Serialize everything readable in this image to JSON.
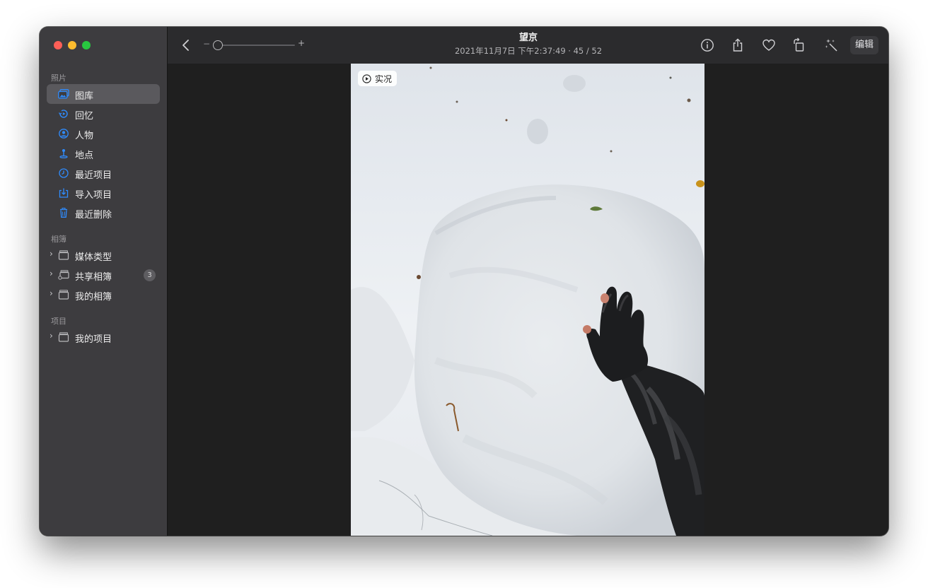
{
  "sidebar": {
    "sections": {
      "photos": "照片",
      "albums": "相簿",
      "projects": "项目"
    },
    "items": [
      {
        "label": "图库",
        "icon": "photo-library-icon",
        "selected": true
      },
      {
        "label": "回忆",
        "icon": "memories-icon"
      },
      {
        "label": "人物",
        "icon": "people-icon"
      },
      {
        "label": "地点",
        "icon": "places-icon"
      },
      {
        "label": "最近项目",
        "icon": "recents-icon"
      },
      {
        "label": "导入项目",
        "icon": "imports-icon"
      },
      {
        "label": "最近删除",
        "icon": "trash-icon"
      }
    ],
    "album_items": [
      {
        "label": "媒体类型",
        "icon": "folder-icon"
      },
      {
        "label": "共享相簿",
        "icon": "shared-folder-icon",
        "badge": "3"
      },
      {
        "label": "我的相簿",
        "icon": "folder-icon"
      }
    ],
    "project_items": [
      {
        "label": "我的项目",
        "icon": "folder-icon"
      }
    ]
  },
  "toolbar": {
    "title": "望京",
    "subtitle": "2021年11月7日 下午2:37:49 · 45 / 52",
    "zoom_minus": "−",
    "zoom_plus": "+",
    "edit_label": "编辑"
  },
  "photo": {
    "live_label": "实况"
  },
  "colors": {
    "accent": "#2f8cff",
    "sidebar_bg": "#3d3c3f",
    "toolbar_bg": "#2b2b2d",
    "content_bg": "#1f1f1f"
  }
}
